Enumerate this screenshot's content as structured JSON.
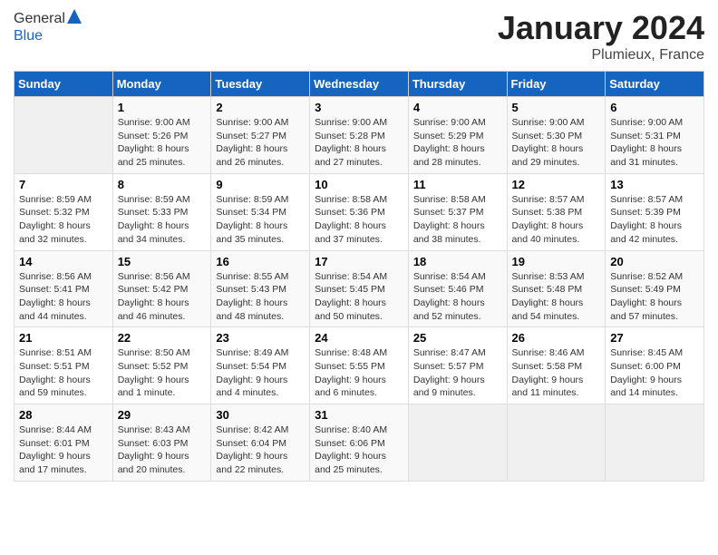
{
  "header": {
    "logo_general": "General",
    "logo_blue": "Blue",
    "month_title": "January 2024",
    "location": "Plumieux, France"
  },
  "days_of_week": [
    "Sunday",
    "Monday",
    "Tuesday",
    "Wednesday",
    "Thursday",
    "Friday",
    "Saturday"
  ],
  "weeks": [
    [
      {
        "day": "",
        "info": ""
      },
      {
        "day": "1",
        "info": "Sunrise: 9:00 AM\nSunset: 5:26 PM\nDaylight: 8 hours\nand 25 minutes."
      },
      {
        "day": "2",
        "info": "Sunrise: 9:00 AM\nSunset: 5:27 PM\nDaylight: 8 hours\nand 26 minutes."
      },
      {
        "day": "3",
        "info": "Sunrise: 9:00 AM\nSunset: 5:28 PM\nDaylight: 8 hours\nand 27 minutes."
      },
      {
        "day": "4",
        "info": "Sunrise: 9:00 AM\nSunset: 5:29 PM\nDaylight: 8 hours\nand 28 minutes."
      },
      {
        "day": "5",
        "info": "Sunrise: 9:00 AM\nSunset: 5:30 PM\nDaylight: 8 hours\nand 29 minutes."
      },
      {
        "day": "6",
        "info": "Sunrise: 9:00 AM\nSunset: 5:31 PM\nDaylight: 8 hours\nand 31 minutes."
      }
    ],
    [
      {
        "day": "7",
        "info": "Sunrise: 8:59 AM\nSunset: 5:32 PM\nDaylight: 8 hours\nand 32 minutes."
      },
      {
        "day": "8",
        "info": "Sunrise: 8:59 AM\nSunset: 5:33 PM\nDaylight: 8 hours\nand 34 minutes."
      },
      {
        "day": "9",
        "info": "Sunrise: 8:59 AM\nSunset: 5:34 PM\nDaylight: 8 hours\nand 35 minutes."
      },
      {
        "day": "10",
        "info": "Sunrise: 8:58 AM\nSunset: 5:36 PM\nDaylight: 8 hours\nand 37 minutes."
      },
      {
        "day": "11",
        "info": "Sunrise: 8:58 AM\nSunset: 5:37 PM\nDaylight: 8 hours\nand 38 minutes."
      },
      {
        "day": "12",
        "info": "Sunrise: 8:57 AM\nSunset: 5:38 PM\nDaylight: 8 hours\nand 40 minutes."
      },
      {
        "day": "13",
        "info": "Sunrise: 8:57 AM\nSunset: 5:39 PM\nDaylight: 8 hours\nand 42 minutes."
      }
    ],
    [
      {
        "day": "14",
        "info": "Sunrise: 8:56 AM\nSunset: 5:41 PM\nDaylight: 8 hours\nand 44 minutes."
      },
      {
        "day": "15",
        "info": "Sunrise: 8:56 AM\nSunset: 5:42 PM\nDaylight: 8 hours\nand 46 minutes."
      },
      {
        "day": "16",
        "info": "Sunrise: 8:55 AM\nSunset: 5:43 PM\nDaylight: 8 hours\nand 48 minutes."
      },
      {
        "day": "17",
        "info": "Sunrise: 8:54 AM\nSunset: 5:45 PM\nDaylight: 8 hours\nand 50 minutes."
      },
      {
        "day": "18",
        "info": "Sunrise: 8:54 AM\nSunset: 5:46 PM\nDaylight: 8 hours\nand 52 minutes."
      },
      {
        "day": "19",
        "info": "Sunrise: 8:53 AM\nSunset: 5:48 PM\nDaylight: 8 hours\nand 54 minutes."
      },
      {
        "day": "20",
        "info": "Sunrise: 8:52 AM\nSunset: 5:49 PM\nDaylight: 8 hours\nand 57 minutes."
      }
    ],
    [
      {
        "day": "21",
        "info": "Sunrise: 8:51 AM\nSunset: 5:51 PM\nDaylight: 8 hours\nand 59 minutes."
      },
      {
        "day": "22",
        "info": "Sunrise: 8:50 AM\nSunset: 5:52 PM\nDaylight: 9 hours\nand 1 minute."
      },
      {
        "day": "23",
        "info": "Sunrise: 8:49 AM\nSunset: 5:54 PM\nDaylight: 9 hours\nand 4 minutes."
      },
      {
        "day": "24",
        "info": "Sunrise: 8:48 AM\nSunset: 5:55 PM\nDaylight: 9 hours\nand 6 minutes."
      },
      {
        "day": "25",
        "info": "Sunrise: 8:47 AM\nSunset: 5:57 PM\nDaylight: 9 hours\nand 9 minutes."
      },
      {
        "day": "26",
        "info": "Sunrise: 8:46 AM\nSunset: 5:58 PM\nDaylight: 9 hours\nand 11 minutes."
      },
      {
        "day": "27",
        "info": "Sunrise: 8:45 AM\nSunset: 6:00 PM\nDaylight: 9 hours\nand 14 minutes."
      }
    ],
    [
      {
        "day": "28",
        "info": "Sunrise: 8:44 AM\nSunset: 6:01 PM\nDaylight: 9 hours\nand 17 minutes."
      },
      {
        "day": "29",
        "info": "Sunrise: 8:43 AM\nSunset: 6:03 PM\nDaylight: 9 hours\nand 20 minutes."
      },
      {
        "day": "30",
        "info": "Sunrise: 8:42 AM\nSunset: 6:04 PM\nDaylight: 9 hours\nand 22 minutes."
      },
      {
        "day": "31",
        "info": "Sunrise: 8:40 AM\nSunset: 6:06 PM\nDaylight: 9 hours\nand 25 minutes."
      },
      {
        "day": "",
        "info": ""
      },
      {
        "day": "",
        "info": ""
      },
      {
        "day": "",
        "info": ""
      }
    ]
  ]
}
